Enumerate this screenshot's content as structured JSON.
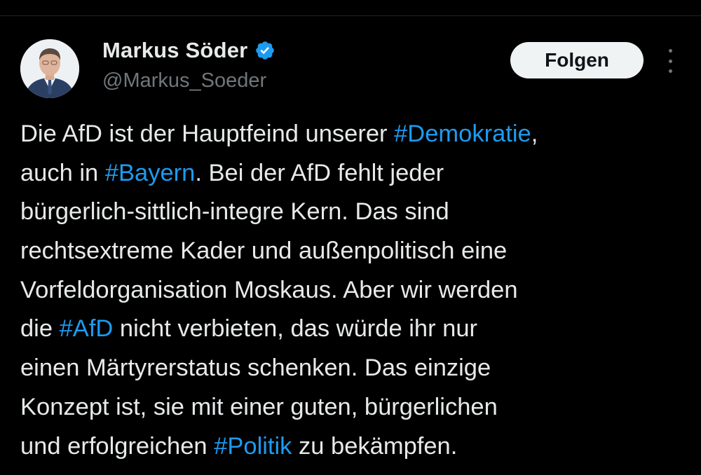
{
  "author": {
    "display_name": "Markus Söder",
    "handle": "@Markus_Soeder",
    "verified_icon": "verified-badge-icon",
    "avatar_icon": "profile-photo"
  },
  "actions": {
    "follow_label": "Folgen",
    "more_icon": "more-vertical-icon"
  },
  "tweet": {
    "lines": [
      [
        {
          "text": "Die AfD ist der Hauptfeind unserer "
        },
        {
          "text": "#Demokratie",
          "hashtag": true
        },
        {
          "text": ","
        }
      ],
      [
        {
          "text": "auch in "
        },
        {
          "text": "#Bayern",
          "hashtag": true
        },
        {
          "text": ". Bei der AfD fehlt jeder"
        }
      ],
      [
        {
          "text": "bürgerlich-sittlich-integre Kern. Das sind"
        }
      ],
      [
        {
          "text": "rechtsextreme Kader und außenpolitisch eine"
        }
      ],
      [
        {
          "text": "Vorfeldorganisation Moskaus. Aber wir werden"
        }
      ],
      [
        {
          "text": "die "
        },
        {
          "text": "#AfD",
          "hashtag": true
        },
        {
          "text": " nicht verbieten, das würde ihr nur"
        }
      ],
      [
        {
          "text": "einen Märtyrerstatus schenken. Das einzige"
        }
      ],
      [
        {
          "text": "Konzept ist, sie mit einer guten, bürgerlichen"
        }
      ],
      [
        {
          "text": "und erfolgreichen "
        },
        {
          "text": "#Politik",
          "hashtag": true
        },
        {
          "text": " zu bekämpfen."
        }
      ]
    ]
  },
  "colors": {
    "background": "#000000",
    "text": "#e7e9ea",
    "secondary_text": "#71767b",
    "hashtag": "#1d9bf0",
    "follow_button_bg": "#eff3f4",
    "follow_button_text": "#0f1419",
    "verified": "#1d9bf0"
  }
}
